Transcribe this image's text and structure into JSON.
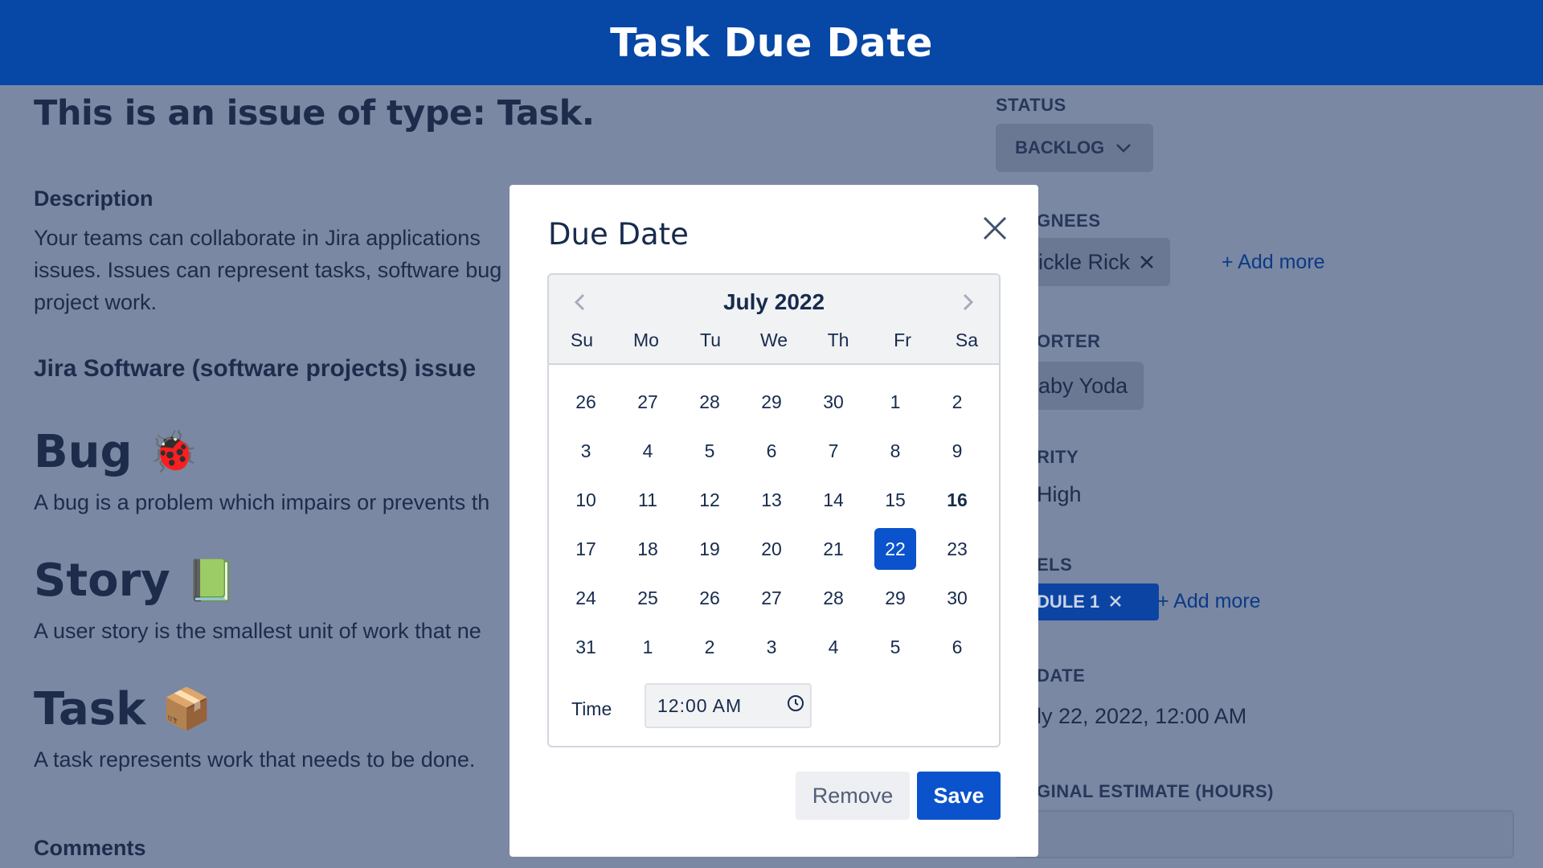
{
  "banner": {
    "title": "Task Due Date"
  },
  "page": {
    "issue_title": "This is an issue of type: Task.",
    "description_label": "Description",
    "description_text": "Your teams can collaborate in Jira applications\nissues. Issues can represent tasks, software bug\nproject work.",
    "subheading": "Jira Software (software projects) issue",
    "types": [
      {
        "name": "Bug",
        "emoji": "🐞",
        "description": "A bug is a problem which impairs or prevents th"
      },
      {
        "name": "Story",
        "emoji": "📗",
        "description": "A user story is the smallest unit of work that ne"
      },
      {
        "name": "Task",
        "emoji": "📦",
        "description": "A task represents work that needs to be done."
      }
    ],
    "comments_label": "Comments"
  },
  "sidebar": {
    "status_label": "STATUS",
    "status_value": "BACKLOG",
    "assignees_label": "GNEES",
    "assignee_name": "Pickle Rick",
    "add_more": "+ Add more",
    "reporter_label": "ORTER",
    "reporter_name": "Baby Yoda",
    "priority_label": "RITY",
    "priority_value": "High",
    "labels_label": "ELS",
    "label_value": "DULE 1",
    "labels_add_more": "+ Add more",
    "due_date_label": "DATE",
    "due_date_value": "ly 22, 2022, 12:00 AM",
    "estimate_label": "GINAL ESTIMATE (HOURS)"
  },
  "modal": {
    "title": "Due Date",
    "month_label": "July 2022",
    "weekdays": [
      "Su",
      "Mo",
      "Tu",
      "We",
      "Th",
      "Fr",
      "Sa"
    ],
    "weeks": [
      [
        "26",
        "27",
        "28",
        "29",
        "30",
        "1",
        "2"
      ],
      [
        "3",
        "4",
        "5",
        "6",
        "7",
        "8",
        "9"
      ],
      [
        "10",
        "11",
        "12",
        "13",
        "14",
        "15",
        "16"
      ],
      [
        "17",
        "18",
        "19",
        "20",
        "21",
        "22",
        "23"
      ],
      [
        "24",
        "25",
        "26",
        "27",
        "28",
        "29",
        "30"
      ],
      [
        "31",
        "1",
        "2",
        "3",
        "4",
        "5",
        "6"
      ]
    ],
    "today_day": "16",
    "selected_day": "22",
    "time_label": "Time",
    "time_value": "12:00 AM",
    "remove_label": "Remove",
    "save_label": "Save"
  },
  "colors": {
    "brand": "#0747a6",
    "primary_button": "#0b53cc",
    "overlay": "#7a88a3"
  }
}
